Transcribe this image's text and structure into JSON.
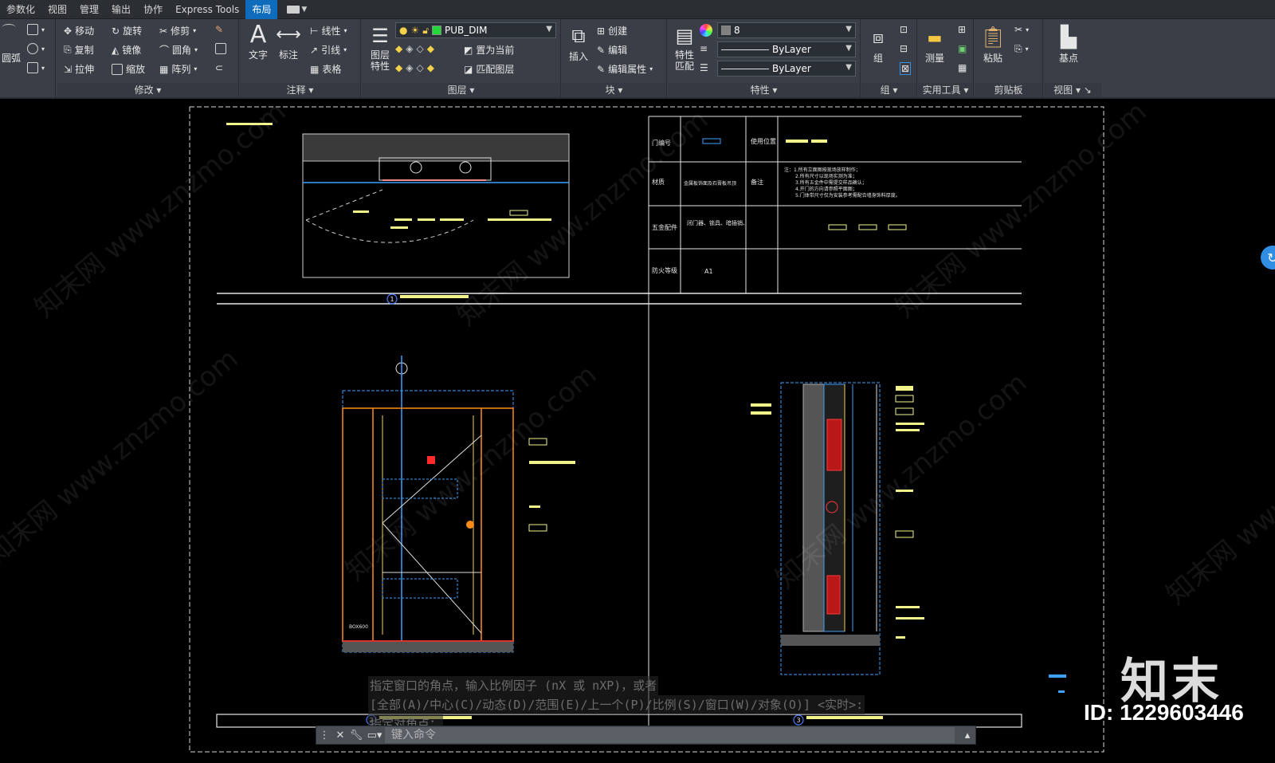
{
  "menu": {
    "tabs": [
      "参数化",
      "视图",
      "管理",
      "输出",
      "协作",
      "Express Tools",
      "布局"
    ],
    "active_tab": "布局"
  },
  "ribbon": {
    "draw_partial": {
      "label": "圆弧"
    },
    "modify": {
      "title": "修改",
      "items": [
        "移动",
        "旋转",
        "修剪",
        "复制",
        "镜像",
        "圆角",
        "拉伸",
        "缩放",
        "阵列"
      ]
    },
    "annotation": {
      "title": "注释",
      "text": "文字",
      "dimension": "标注",
      "linear": "线性",
      "leader": "引线",
      "table": "表格"
    },
    "layers": {
      "title": "图层",
      "layer_props": "图层特性",
      "current_layer": "PUB_DIM",
      "set_current": "置为当前",
      "match_layer": "匹配图层",
      "layer_color": "#22d93a"
    },
    "block": {
      "title": "块",
      "insert": "插入",
      "create": "创建",
      "edit": "编辑",
      "edit_attr": "编辑属性"
    },
    "properties": {
      "title": "特性",
      "match": "特性匹配",
      "color_value": "8",
      "linetype": "ByLayer",
      "lineweight": "ByLayer"
    },
    "groups": {
      "title": "组",
      "label": "组"
    },
    "utilities": {
      "title": "实用工具",
      "measure": "测量"
    },
    "clipboard": {
      "title": "剪贴板",
      "paste": "粘贴"
    },
    "view": {
      "title": "视图",
      "base": "基点"
    }
  },
  "drawing": {
    "table": {
      "door_no": "门编号",
      "use_location": "使用位置",
      "material": "材质",
      "material_value": "金属板饰面及石膏板吊顶",
      "remark": "备注",
      "notes": [
        "注：1.所有立面图按现场放样制作；",
        "2.所有尺寸以现场实测为准；",
        "3.所有五金件中需提交样品确认；",
        "4.开门的方向请参照平面图；",
        "5.门体带尺寸仅为安装参考需配合墙身饰料厚度。"
      ],
      "hardware": "五金配件",
      "hardware_value": "闭门器、锁具、暗插销、",
      "fire_rating": "防火等级",
      "fire_value": "A1"
    },
    "view_numbers": [
      "1",
      "2",
      "3"
    ],
    "dims": [
      "BOX600",
      "1400"
    ]
  },
  "command": {
    "history": [
      "指定窗口的角点，输入比例因子 (nX 或 nXP)，或者",
      "[全部(A)/中心(C)/动态(D)/范围(E)/上一个(P)/比例(S)/窗口(W)/对象(O)] <实时>:",
      "指定对角点："
    ],
    "placeholder": "键入命令"
  },
  "watermark": {
    "text": "知末网 www.znzmo.com",
    "brand": "知末",
    "id": "ID: 1229603446"
  }
}
